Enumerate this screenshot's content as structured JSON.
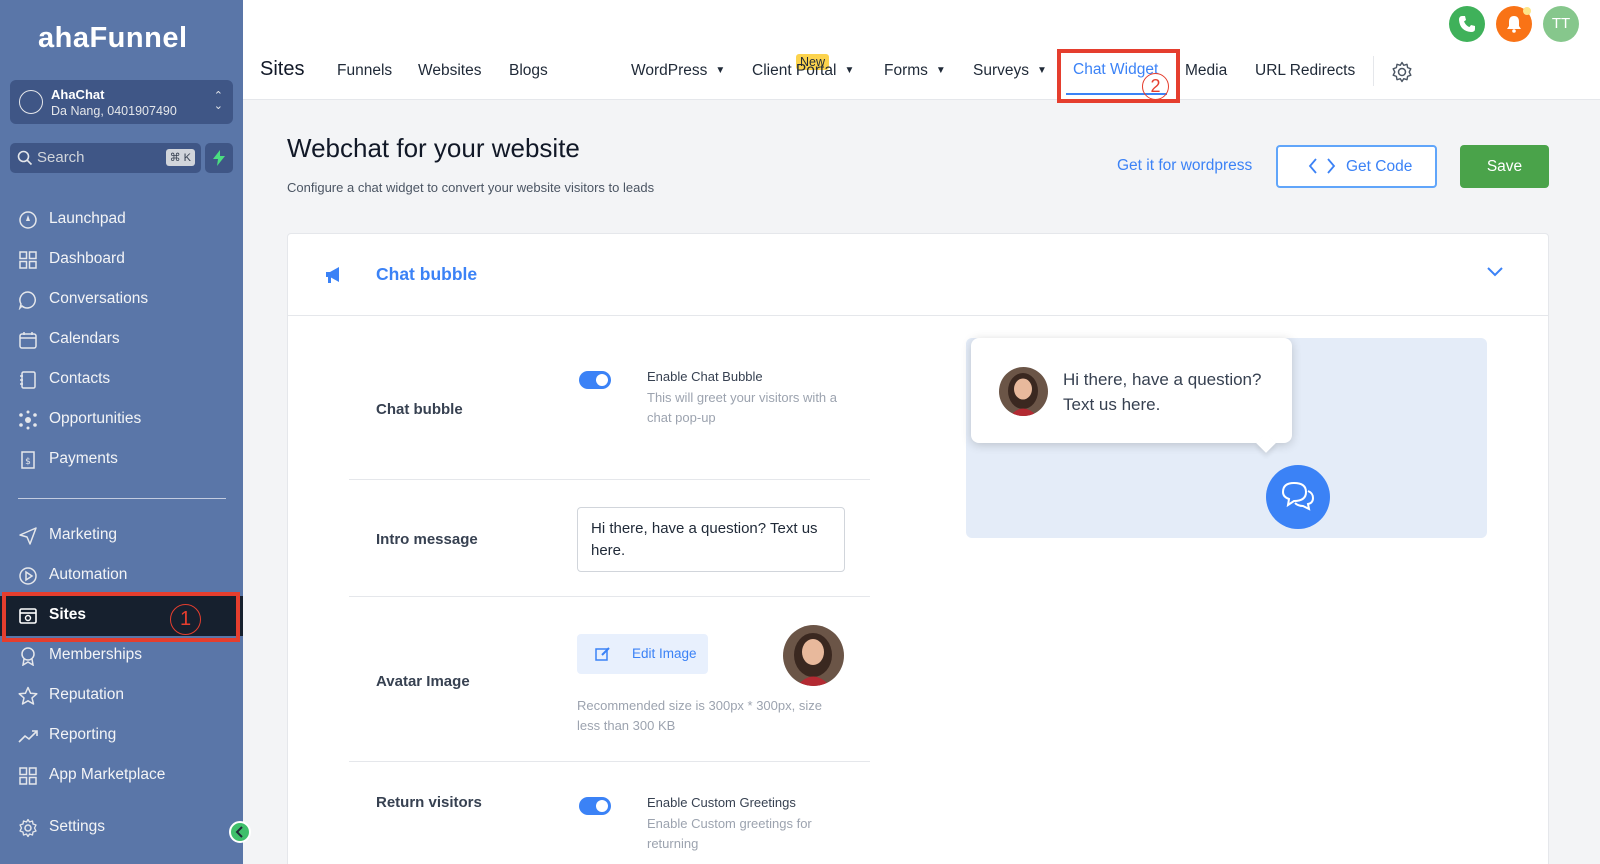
{
  "sidebar": {
    "logo": "ahaFunnel",
    "account": {
      "name": "AhaChat",
      "location": "Da Nang, 0401907490"
    },
    "search": {
      "placeholder": "Search",
      "shortcut": "⌘ K"
    },
    "items": [
      {
        "label": "Launchpad",
        "icon": "rocket-icon"
      },
      {
        "label": "Dashboard",
        "icon": "grid-icon"
      },
      {
        "label": "Conversations",
        "icon": "chat-icon"
      },
      {
        "label": "Calendars",
        "icon": "calendar-icon"
      },
      {
        "label": "Contacts",
        "icon": "contacts-icon"
      },
      {
        "label": "Opportunities",
        "icon": "opportunities-icon"
      },
      {
        "label": "Payments",
        "icon": "payments-icon"
      },
      {
        "label": "Marketing",
        "icon": "send-icon"
      },
      {
        "label": "Automation",
        "icon": "automation-icon"
      },
      {
        "label": "Sites",
        "icon": "sites-icon",
        "active": true
      },
      {
        "label": "Memberships",
        "icon": "memberships-icon"
      },
      {
        "label": "Reputation",
        "icon": "star-icon"
      },
      {
        "label": "Reporting",
        "icon": "trend-icon"
      },
      {
        "label": "App Marketplace",
        "icon": "grid-icon"
      },
      {
        "label": "Settings",
        "icon": "gear-icon"
      }
    ]
  },
  "topbar": {
    "section_title": "Sites",
    "tabs": [
      {
        "label": "Funnels"
      },
      {
        "label": "Websites"
      },
      {
        "label": "Blogs",
        "badge": "New"
      },
      {
        "label": "WordPress",
        "dropdown": true
      },
      {
        "label": "Client Portal",
        "dropdown": true
      },
      {
        "label": "Forms",
        "dropdown": true
      },
      {
        "label": "Surveys",
        "dropdown": true
      },
      {
        "label": "Chat Widget",
        "active": true
      },
      {
        "label": "Media"
      },
      {
        "label": "URL Redirects"
      }
    ],
    "user_initials": "TT"
  },
  "page": {
    "title": "Webchat for your website",
    "subtitle": "Configure a chat widget to convert your website visitors to leads",
    "wordpress_link": "Get it for wordpress",
    "get_code_label": "Get Code",
    "save_label": "Save"
  },
  "card": {
    "title": "Chat bubble",
    "chat_bubble": {
      "label": "Chat bubble",
      "toggle_on": true,
      "option_title": "Enable Chat Bubble",
      "option_desc": "This will greet your visitors with a chat pop-up"
    },
    "intro_message": {
      "label": "Intro message",
      "value": "Hi there, have a question? Text us here."
    },
    "avatar_image": {
      "label": "Avatar Image",
      "edit_label": "Edit Image",
      "note": "Recommended size is 300px * 300px, size less than 300 KB"
    },
    "return_visitors": {
      "label": "Return visitors",
      "toggle_on": true,
      "option_title": "Enable Custom Greetings",
      "option_desc": "Enable Custom greetings for returning"
    },
    "preview": {
      "bubble_text": "Hi there, have a question? Text us here."
    }
  },
  "annotations": {
    "step1": "1",
    "step2": "2"
  },
  "colors": {
    "sidebar_bg": "#5a76a8",
    "accent": "#3b82f6",
    "save_green": "#4aa34a",
    "annotation_red": "#e53e2e"
  }
}
